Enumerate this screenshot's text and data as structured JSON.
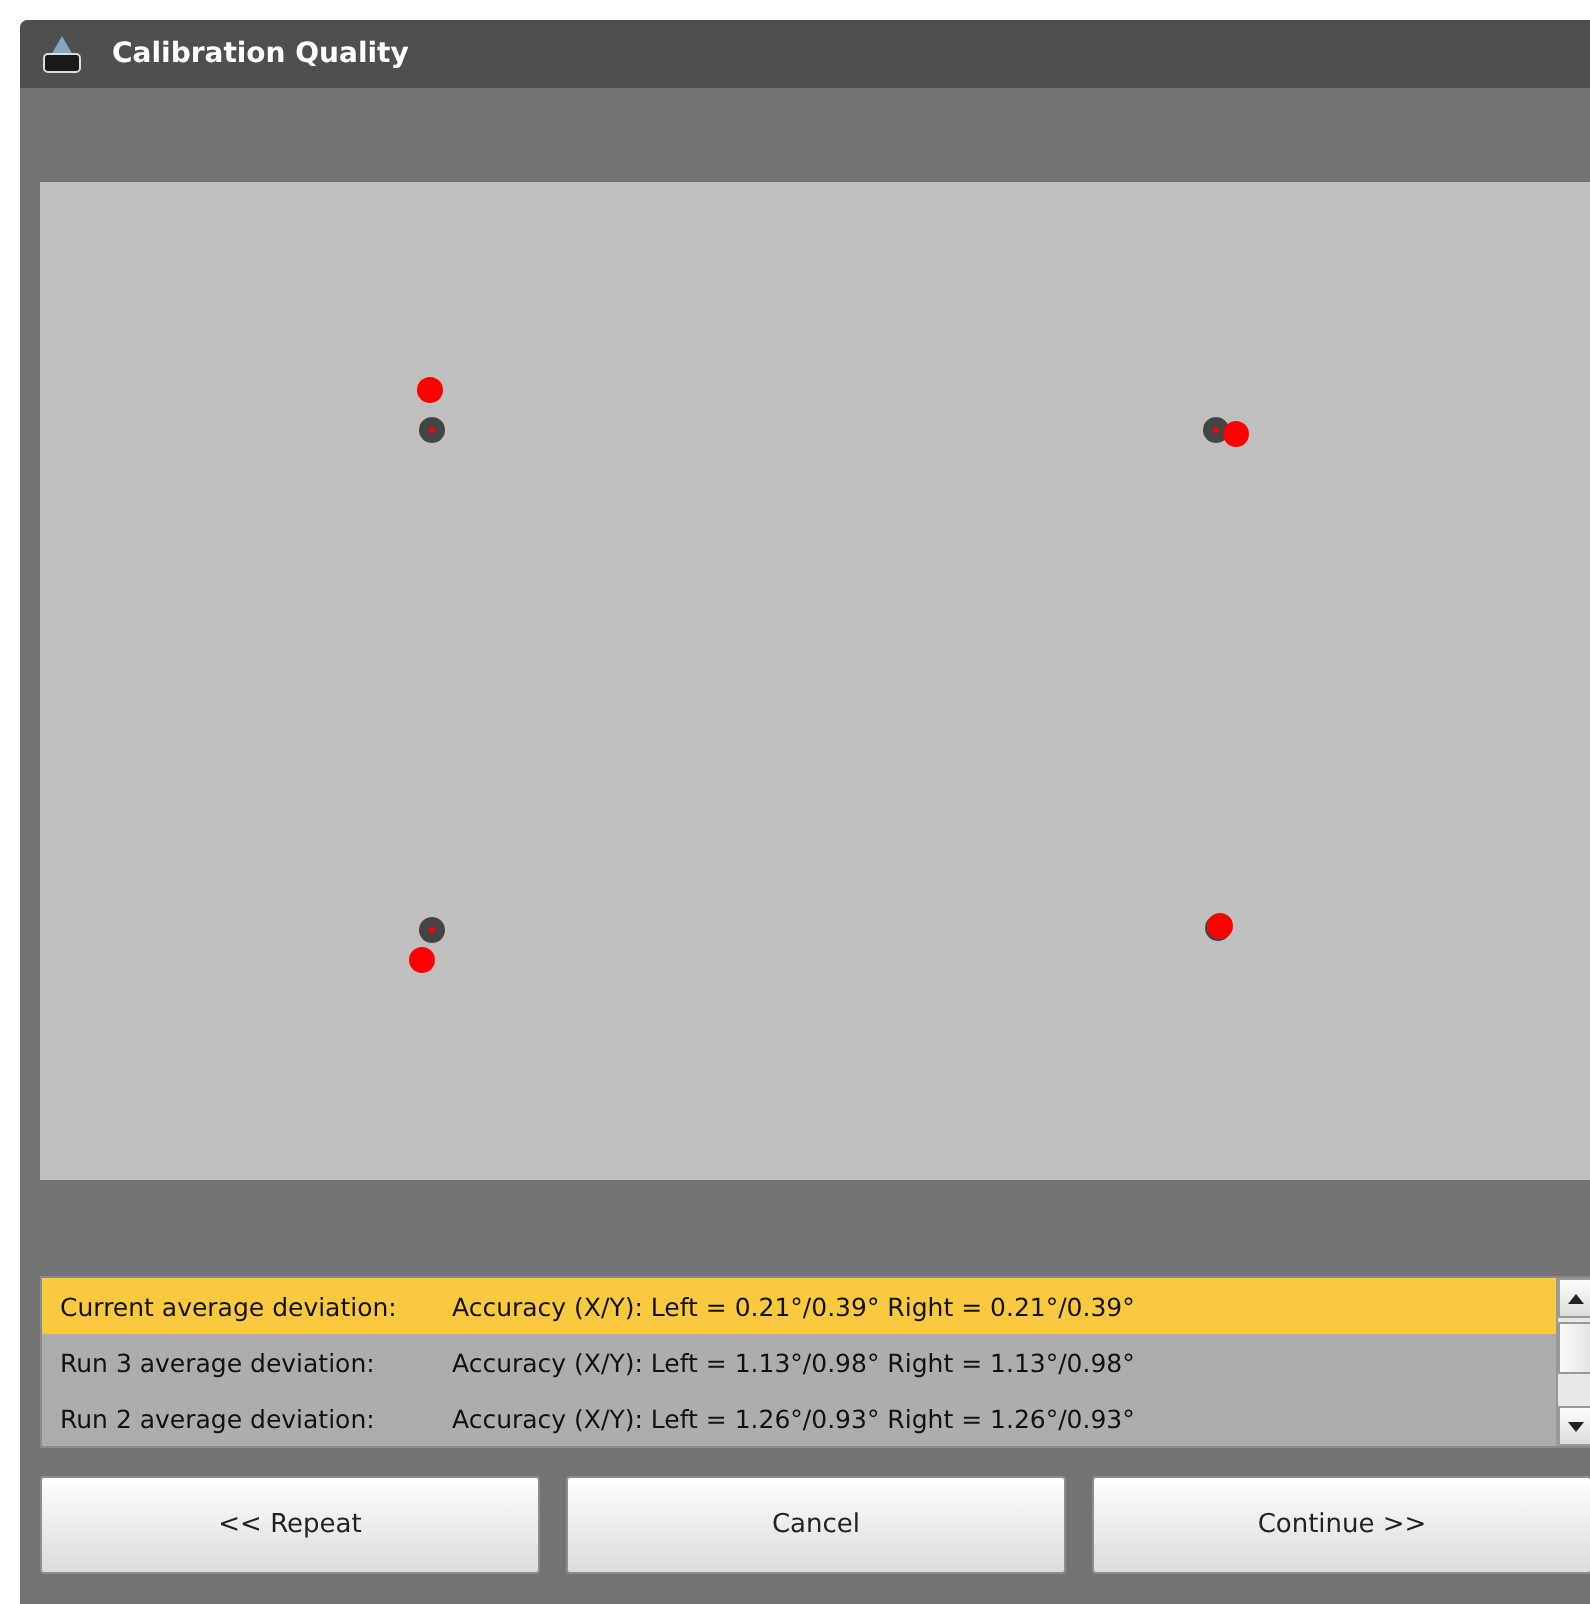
{
  "window": {
    "title": "Calibration Quality"
  },
  "results": [
    {
      "label": "Current average deviation:",
      "value": "Accuracy (X/Y): Left = 0.21°/0.39° Right = 0.21°/0.39°",
      "selected": true
    },
    {
      "label": "Run 3 average deviation:",
      "value": "Accuracy (X/Y): Left = 1.13°/0.98° Right = 1.13°/0.98°",
      "selected": false
    },
    {
      "label": "Run 2 average deviation:",
      "value": "Accuracy (X/Y): Left = 1.26°/0.93° Right = 1.26°/0.93°",
      "selected": false
    }
  ],
  "buttons": [
    "<< Repeat",
    "Cancel",
    "Continue >>"
  ]
}
